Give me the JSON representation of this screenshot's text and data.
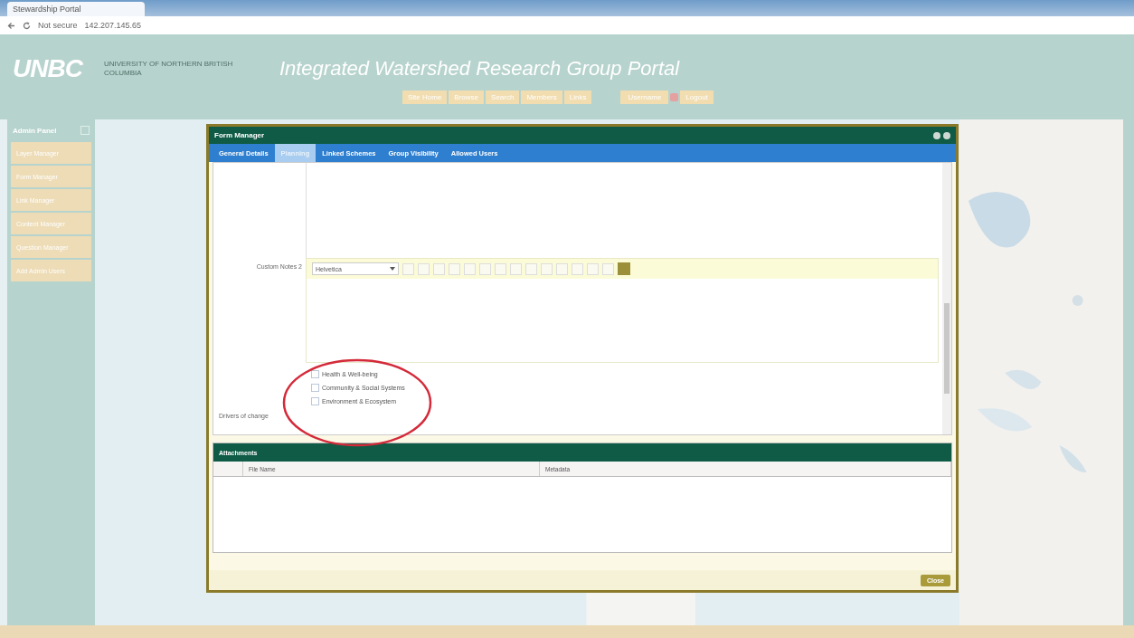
{
  "browser": {
    "tab_title": "Stewardship Portal",
    "security": "Not secure",
    "address": "142.207.145.65"
  },
  "header": {
    "logo": "UNBC",
    "logo_subtitle": "UNIVERSITY OF NORTHERN BRITISH COLUMBIA",
    "title": "Integrated Watershed Research Group Portal",
    "nav": [
      "Site Home",
      "Browse",
      "Search",
      "Members",
      "Links"
    ],
    "user": "Username",
    "logout": "Logout"
  },
  "sidebar": {
    "title": "Admin Panel",
    "items": [
      {
        "label": "Layer Manager"
      },
      {
        "label": "Form Manager"
      },
      {
        "label": "Link Manager"
      },
      {
        "label": "Content Manager"
      },
      {
        "label": "Question Manager"
      },
      {
        "label": "Add Admin Users"
      }
    ]
  },
  "dialog": {
    "title": "Form Manager",
    "tabs": [
      {
        "label": "General Details",
        "selected": false
      },
      {
        "label": "Planning",
        "selected": true
      },
      {
        "label": "Linked Schemes",
        "selected": false
      },
      {
        "label": "Group Visibility",
        "selected": false
      },
      {
        "label": "Allowed Users",
        "selected": false
      }
    ],
    "editor_label": "Custom Notes 2",
    "font": "Helvetica",
    "checkboxes": [
      {
        "label": "Health & Well-being",
        "checked": false
      },
      {
        "label": "Community & Social Systems",
        "checked": false
      },
      {
        "label": "Environment & Ecosystem",
        "checked": false
      }
    ],
    "drivers_label": "Drivers of change",
    "attachments": {
      "title": "Attachments",
      "columns": [
        "File Name",
        "Metadata"
      ]
    },
    "close": "Close"
  }
}
